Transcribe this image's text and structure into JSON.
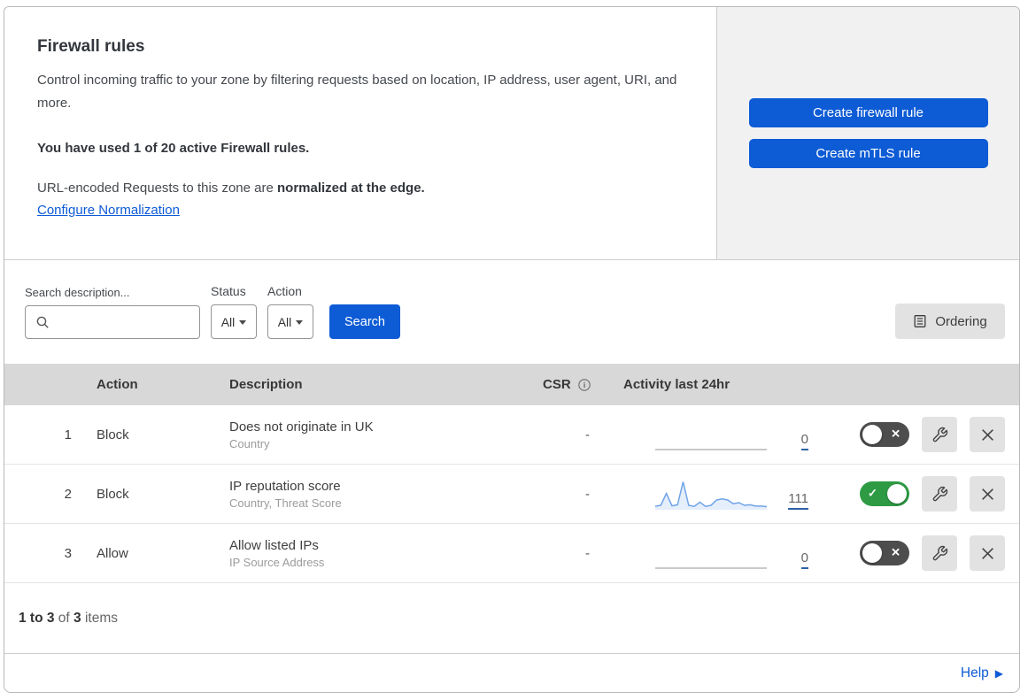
{
  "overview": {
    "title": "Firewall rules",
    "description": "Control incoming traffic to your zone by filtering requests based on location, IP address, user agent, URI, and more.",
    "usage_notice": "You have used 1 of 20 active Firewall rules.",
    "normalization_prefix": "URL-encoded Requests to this zone are ",
    "normalization_bold": "normalized at the edge.",
    "normalization_link": "Configure Normalization",
    "create_firewall_button": "Create firewall rule",
    "create_mtls_button": "Create mTLS rule"
  },
  "filters": {
    "search_label": "Search description...",
    "search_value": "",
    "status_label": "Status",
    "status_value": "All",
    "action_label": "Action",
    "action_value": "All",
    "search_button": "Search",
    "ordering_button": "Ordering"
  },
  "table": {
    "headers": {
      "action": "Action",
      "description": "Description",
      "csr": "CSR",
      "activity": "Activity last 24hr"
    },
    "rows": [
      {
        "priority": "1",
        "action": "Block",
        "description": "Does not originate in UK",
        "match_fields": "Country",
        "csr": "-",
        "activity_count": "0",
        "enabled": false,
        "sparkline": []
      },
      {
        "priority": "2",
        "action": "Block",
        "description": "IP reputation score",
        "match_fields": "Country, Threat Score",
        "csr": "-",
        "activity_count": "111",
        "enabled": true,
        "sparkline": [
          6,
          10,
          55,
          8,
          12,
          98,
          10,
          6,
          22,
          6,
          10,
          30,
          34,
          30,
          16,
          20,
          10,
          12,
          7,
          7,
          5
        ]
      },
      {
        "priority": "3",
        "action": "Allow",
        "description": "Allow listed IPs",
        "match_fields": "IP Source Address",
        "csr": "-",
        "activity_count": "0",
        "enabled": false,
        "sparkline": []
      }
    ]
  },
  "footer": {
    "range": "1 to 3",
    "of_text": " of ",
    "total": "3",
    "items_text": " items",
    "help_link": "Help"
  },
  "icons": {
    "check": "✓",
    "cross": "✕",
    "help_arrow": "▶"
  },
  "colors": {
    "primary_blue": "#0d5bd5",
    "toggle_on_green": "#2e9b44",
    "toggle_off_gray": "#4d4d4d",
    "table_header_gray": "#d8d8d8",
    "side_panel_gray": "#f1f1f2",
    "spark_blue": "#6fa3e8",
    "count_underline": "#2e62a6"
  }
}
